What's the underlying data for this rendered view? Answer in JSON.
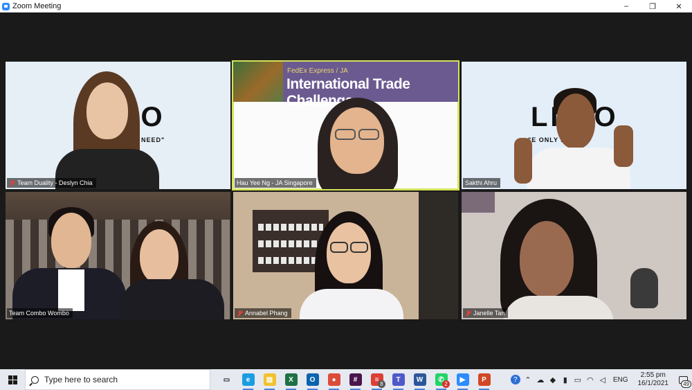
{
  "window": {
    "title": "Zoom Meeting",
    "controls": [
      "–",
      "❐",
      "✕"
    ]
  },
  "participants": [
    {
      "name": "Team Duality - Deslyn Chia",
      "muted": true
    },
    {
      "name": "Hau Yee Ng - JA Singapore",
      "muted": false,
      "active_speaker": true
    },
    {
      "name": "Sakthi Ahru",
      "muted": false
    },
    {
      "name": "Team Combo Wombo",
      "muted": false
    },
    {
      "name": "Annabel Phang",
      "muted": true
    },
    {
      "name": "Janelle Tan",
      "muted": true
    }
  ],
  "backgrounds": {
    "tile1_text": "LI  RO",
    "tile1_slogan": "NEED\"",
    "tile2_banner_small": "FedEx Express / JA",
    "tile2_banner_large": "International Trade Challenge",
    "tile3_text": "LI  RO",
    "tile3_slogan": "\"E ONLY      H N"
  },
  "taskbar": {
    "search_placeholder": "Type here to search",
    "apps": [
      {
        "icon": "task-view-icon",
        "color": "#e6e9f0"
      },
      {
        "icon": "edge-icon",
        "color": "#1b9de2"
      },
      {
        "icon": "file-explorer-icon",
        "color": "#f2c12e"
      },
      {
        "icon": "excel-icon",
        "color": "#1e7145"
      },
      {
        "icon": "outlook-icon",
        "color": "#0a64ad"
      },
      {
        "icon": "chrome-icon",
        "color": "#dd4b39"
      },
      {
        "icon": "slack-icon",
        "color": "#4a154b"
      },
      {
        "icon": "todoist-icon",
        "color": "#db4035",
        "badge": "8"
      },
      {
        "icon": "teams-icon",
        "color": "#5059c9"
      },
      {
        "icon": "word-icon",
        "color": "#2b579a"
      },
      {
        "icon": "whatsapp-icon",
        "color": "#25d366",
        "badge": "2"
      },
      {
        "icon": "zoom-icon",
        "color": "#2d8cff"
      },
      {
        "icon": "powerpoint-icon",
        "color": "#d24726"
      }
    ],
    "language": "ENG",
    "time": "2:55 pm",
    "date": "16/1/2021",
    "notifications": "49"
  }
}
